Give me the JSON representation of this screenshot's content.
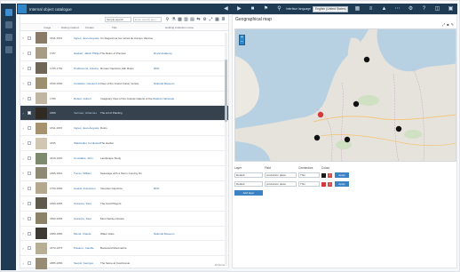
{
  "app": {
    "title": "Internal object catalogue"
  },
  "header": {
    "icons": [
      "back-icon",
      "forward-icon",
      "bookmark-icon",
      "flag-icon",
      "search-icon"
    ],
    "language_label": "Interface language",
    "language_value": "English (United States)",
    "right_icons": [
      "grid-icon",
      "list-icon",
      "warning-icon",
      "more-icon",
      "gear-icon",
      "help-icon",
      "split-view-icon",
      "window-icon"
    ]
  },
  "rail": {
    "items": [
      "catalogue",
      "map",
      "analysis",
      "settings"
    ]
  },
  "catalogue": {
    "toolbar": {
      "select_value": "Simple search",
      "search_placeholder": "Enter search term",
      "icons": [
        "search-icon",
        "filter-icon",
        "map-icon",
        "chart-icon",
        "table-icon",
        "compare-icon",
        "settings-icon",
        "expand-icon",
        "grid-icon",
        "list-icon"
      ]
    },
    "columns": [
      "Image",
      "Dating created",
      "Creator",
      "Title",
      "Holding institution name"
    ],
    "rows": [
      {
        "date": "1811-1815",
        "creator": "Ingres, Jean-Auguste",
        "title": "Un Regard sur les ruines du Campo Vaccino",
        "collection": "",
        "thumb": "#8a7b68"
      },
      {
        "date": "1787",
        "creator": "Hackert, Jakob Philipp",
        "title": "The Ruins of Pompeii",
        "collection": "Royal Academy",
        "thumb": "#a69c86"
      },
      {
        "date": "1755-1760",
        "creator": "Prudhomme, Antoine",
        "title": "Roman Capriccio with Ruins",
        "collection": "RKD",
        "thumb": "#6f6657"
      },
      {
        "date": "1830-1840",
        "creator": "Canaletto, Giovanni Antonio",
        "title": "View of the Grand Canal, Venice",
        "collection": "National Museum",
        "thumb": "#9c8f70"
      },
      {
        "date": "1780",
        "creator": "Robert, Hubert",
        "title": "Imaginary View of the Grande Galerie of the Louvre",
        "collection": "Galerie Nationale",
        "thumb": "#bfb7a3"
      },
      {
        "date": "1666",
        "creator": "Vermeer, Johannes",
        "title": "The Art of Painting",
        "collection": "",
        "thumb": "#2f2a22"
      },
      {
        "date": "1811-1815",
        "creator": "Ingres, Jean-Auguste",
        "title": "Ruins",
        "collection": "",
        "thumb": "#a79270"
      },
      {
        "date": "1835",
        "creator": "Waldmüller, Ferdinand",
        "title": "The Harbor",
        "collection": "",
        "thumb": "#cfc7b2"
      },
      {
        "date": "1810-1820",
        "creator": "Constable, John",
        "title": "Landscape Study",
        "collection": "",
        "thumb": "#7d8a6e"
      },
      {
        "date": "1805-1810",
        "creator": "Turner, William",
        "title": "Seascape with a Storm Coming On",
        "collection": "",
        "thumb": "#8f8a76"
      },
      {
        "date": "1790-1800",
        "creator": "Guardi, Francesco",
        "title": "Venetian Capriccio",
        "collection": "RKD",
        "thumb": "#b3a98f"
      },
      {
        "date": "1890-1895",
        "creator": "Cézanne, Paul",
        "title": "The Card Players",
        "collection": "",
        "thumb": "#5e5a4c"
      },
      {
        "date": "1890-1895",
        "creator": "Cézanne, Paul",
        "title": "Mont Sainte-Victoire",
        "collection": "",
        "thumb": "#8c8268"
      },
      {
        "date": "1880-1890",
        "creator": "Monet, Claude",
        "title": "Water Lilies",
        "collection": "National Museum",
        "thumb": "#3c3a32"
      },
      {
        "date": "1870-1875",
        "creator": "Pissarro, Camille",
        "title": "Boulevard Montmartre",
        "collection": "",
        "thumb": "#b8ad95"
      },
      {
        "date": "1885-1890",
        "creator": "Seurat, Georges",
        "title": "The Seine at Courbevoie",
        "collection": "",
        "thumb": "#968c76"
      }
    ],
    "selected_row": 5,
    "footer": "16 items"
  },
  "map_panel": {
    "title": "Geographical map",
    "tool_icons": [
      "fullscreen-icon",
      "camera-icon",
      "pin-icon"
    ],
    "zoom_in": "+",
    "zoom_out": "−",
    "layers": {
      "headers": [
        "Layer",
        "Field",
        "Connectors",
        "Colour"
      ],
      "rows": [
        {
          "layer": "Default",
          "field": "production place",
          "connectors": "Thin",
          "color": "#1a1a1a",
          "button": "Apply"
        },
        {
          "layer": "Default",
          "field": "production place",
          "connectors": "Thin",
          "color": "#d33b3b",
          "button": "Apply"
        }
      ],
      "add_button": "Add layer"
    },
    "markers": [
      {
        "city": "Copenhagen",
        "color": "#111111"
      },
      {
        "city": "Amsterdam",
        "color": "#d33b3b"
      },
      {
        "city": "Berlin",
        "color": "#111111"
      },
      {
        "city": "Prague",
        "color": "#111111"
      },
      {
        "city": "Brussels",
        "color": "#111111"
      },
      {
        "city": "Hamburg",
        "color": "#111111"
      }
    ]
  }
}
